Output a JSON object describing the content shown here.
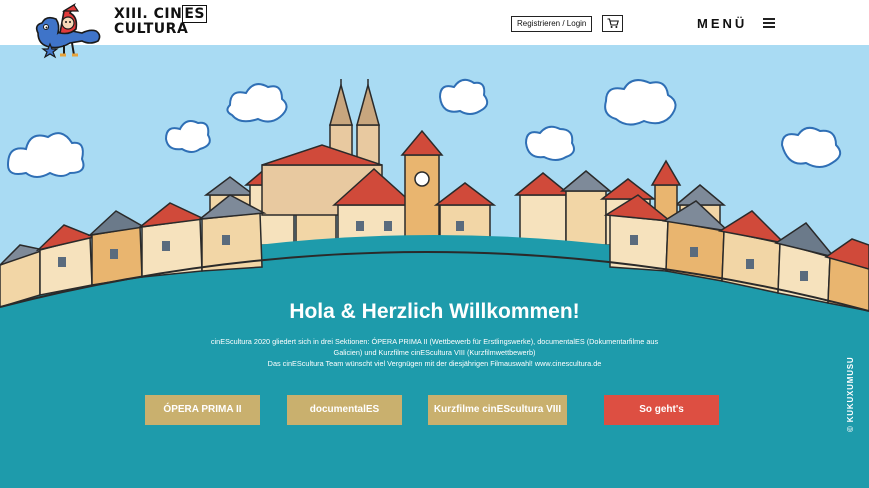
{
  "header": {
    "logo_line1": "XIII. CIN",
    "logo_boxed": "ES",
    "logo_line2": "CULTURA",
    "register_label": "Registrieren / Login",
    "menu_label": "MENÜ",
    "icons": [
      "cart-icon",
      "hamburger-icon"
    ]
  },
  "main": {
    "title": "Hola & Herzlich Willkommen!",
    "intro_line1": "cinEScultura 2020 gliedert sich in drei Sektionen: ÓPERA PRIMA II (Wettbewerb für Erstlingswerke), documentalES (Dokumentarfilme aus",
    "intro_line2": "Galicien) und Kurzfilme cinEScultura VIII (Kurzfilmwettbewerb)",
    "intro_line3": "Das cinEScultura Team wünscht viel Vergnügen mit der diesjährigen Filmauswahl! www.cinescultura.de"
  },
  "buttons": {
    "opera": "ÓPERA PRIMA II",
    "documentales": "documentalES",
    "kurzfilme": "Kurzfilme cinEScultura VIII",
    "so_gehts": "So geht's"
  },
  "credit": "© KUKUXUMUSU",
  "colors": {
    "sky": "#a9dbf3",
    "teal": "#1e9bab",
    "gold_button": "#c9b06e",
    "red_button": "#dd4f42"
  }
}
